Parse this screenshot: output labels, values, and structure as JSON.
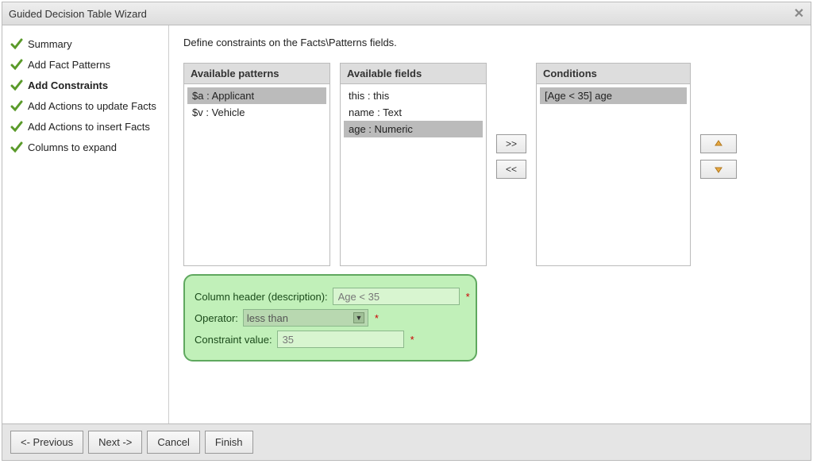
{
  "title": "Guided Decision Table Wizard",
  "steps": [
    {
      "label": "Summary"
    },
    {
      "label": "Add Fact Patterns"
    },
    {
      "label": "Add Constraints"
    },
    {
      "label": "Add Actions to update Facts"
    },
    {
      "label": "Add Actions to insert Facts"
    },
    {
      "label": "Columns to expand"
    }
  ],
  "instruction": "Define constraints on the Facts\\Patterns fields.",
  "panel_patterns_header": "Available patterns",
  "panel_fields_header": "Available fields",
  "panel_conditions_header": "Conditions",
  "patterns": [
    {
      "label": "$a : Applicant",
      "selected": true
    },
    {
      "label": "$v : Vehicle",
      "selected": false
    }
  ],
  "fields": [
    {
      "label": "this : this",
      "selected": false
    },
    {
      "label": "name : Text",
      "selected": false
    },
    {
      "label": "age : Numeric",
      "selected": true
    }
  ],
  "conditions": [
    {
      "label": "[Age < 35] age",
      "selected": true
    }
  ],
  "transfer": {
    "add": ">>",
    "remove": "<<"
  },
  "form": {
    "header_label": "Column header (description):",
    "header_value": "Age < 35",
    "operator_label": "Operator:",
    "operator_value": "less than",
    "constraint_label": "Constraint value:",
    "constraint_value": "35",
    "required": "*"
  },
  "footer": {
    "prev": "<- Previous",
    "next": "Next ->",
    "cancel": "Cancel",
    "finish": "Finish"
  }
}
